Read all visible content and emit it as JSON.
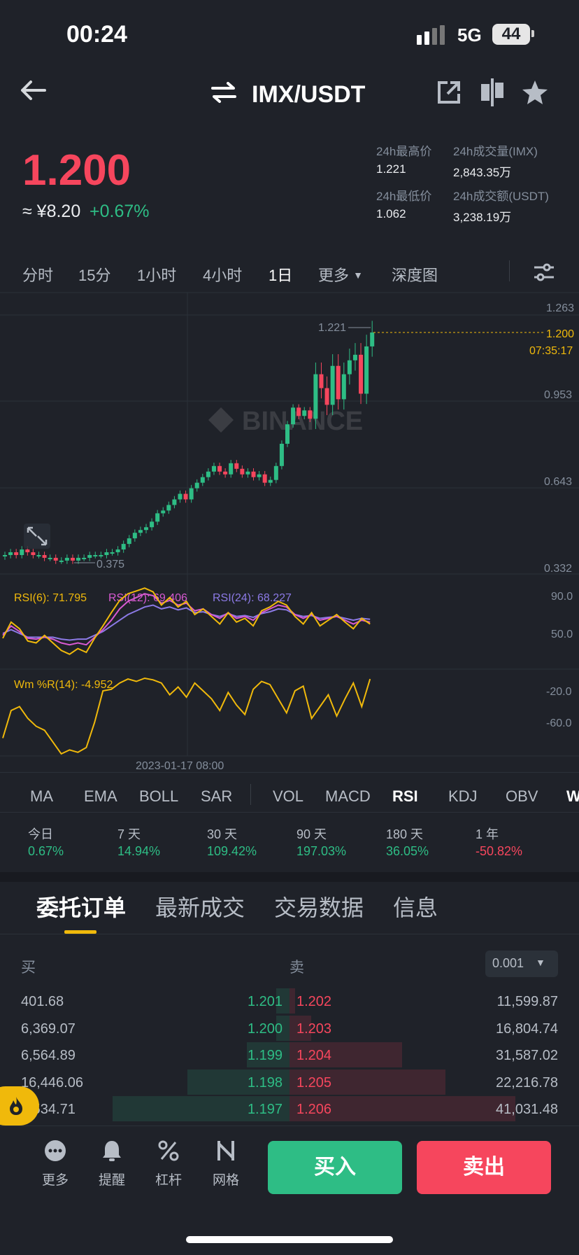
{
  "status": {
    "time": "00:24",
    "network": "5G",
    "battery": "44"
  },
  "header": {
    "pair": "IMX/USDT"
  },
  "price": {
    "last": "1.200",
    "cny": "≈ ¥8.20",
    "change": "+0.67%"
  },
  "stats": {
    "high_label": "24h最高价",
    "high": "1.221",
    "low_label": "24h最低价",
    "low": "1.062",
    "vol_label": "24h成交量(IMX)",
    "vol": "2,843.35万",
    "amt_label": "24h成交额(USDT)",
    "amt": "3,238.19万"
  },
  "time_tabs": [
    "分时",
    "15分",
    "1小时",
    "4小时",
    "1日",
    "更多",
    "深度图"
  ],
  "chart": {
    "watermark": "BINANCE",
    "price_axis": [
      "1.263",
      "0.953",
      "0.643",
      "0.332"
    ],
    "current_price": "1.200",
    "countdown": "07:35:17",
    "high_mark": "1.221",
    "low_mark": "0.375",
    "rsi_label_6": "RSI(6): 71.795",
    "rsi_label_12": "RSI(12): 69.406",
    "rsi_label_24": "RSI(24): 68.227",
    "rsi_axis": [
      "90.0",
      "50.0"
    ],
    "wr_label": "Wm %R(14): -4.952",
    "wr_axis": [
      "-20.0",
      "-60.0"
    ],
    "date_label": "2023-01-17 08:00",
    "colors": {
      "up": "#2ebd85",
      "down": "#f6465d",
      "rsi6": "#f0b90b",
      "rsi12": "#d85ad2",
      "rsi24": "#8c7ae6",
      "wr": "#f0b90b"
    }
  },
  "indicator_tabs": [
    "MA",
    "EMA",
    "BOLL",
    "SAR",
    "VOL",
    "MACD",
    "RSI",
    "KDJ",
    "OBV",
    "W"
  ],
  "performance": [
    {
      "label": "今日",
      "value": "0.67%",
      "dir": "up"
    },
    {
      "label": "7 天",
      "value": "14.94%",
      "dir": "up"
    },
    {
      "label": "30 天",
      "value": "109.42%",
      "dir": "up"
    },
    {
      "label": "90 天",
      "value": "197.03%",
      "dir": "up"
    },
    {
      "label": "180 天",
      "value": "36.05%",
      "dir": "up"
    },
    {
      "label": "1 年",
      "value": "-50.82%",
      "dir": "down"
    }
  ],
  "section_tabs": [
    "委托订单",
    "最新成交",
    "交易数据",
    "信息"
  ],
  "orderbook": {
    "buy_label": "买",
    "sell_label": "卖",
    "precision": "0.001",
    "rows": [
      {
        "bid_qty": "401.68",
        "bid_price": "1.201",
        "ask_price": "1.202",
        "ask_qty": "11,599.87",
        "bid_depth": 0.05,
        "ask_depth": 0.02
      },
      {
        "bid_qty": "6,369.07",
        "bid_price": "1.200",
        "ask_price": "1.203",
        "ask_qty": "16,804.74",
        "bid_depth": 0.05,
        "ask_depth": 0.08
      },
      {
        "bid_qty": "6,564.89",
        "bid_price": "1.199",
        "ask_price": "1.204",
        "ask_qty": "31,587.02",
        "bid_depth": 0.16,
        "ask_depth": 0.42
      },
      {
        "bid_qty": "16,446.06",
        "bid_price": "1.198",
        "ask_price": "1.205",
        "ask_qty": "22,216.78",
        "bid_depth": 0.38,
        "ask_depth": 0.58
      },
      {
        "bid_qty": "2,534.71",
        "bid_price": "1.197",
        "ask_price": "1.206",
        "ask_qty": "41,031.48",
        "bid_depth": 0.66,
        "ask_depth": 0.84
      }
    ]
  },
  "bottom_nav": [
    {
      "label": "更多",
      "icon": "more-icon"
    },
    {
      "label": "提醒",
      "icon": "bell-icon"
    },
    {
      "label": "杠杆",
      "icon": "leverage-icon"
    },
    {
      "label": "网格",
      "icon": "grid-icon"
    }
  ],
  "actions": {
    "buy": "买入",
    "sell": "卖出"
  }
}
